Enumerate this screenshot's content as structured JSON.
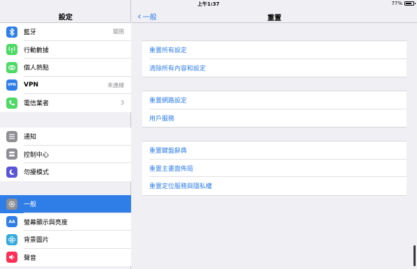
{
  "status_bar": {
    "time": "上午1:37",
    "battery": "77%",
    "battery_level": 0.77
  },
  "sidebar": {
    "title": "設定",
    "group1": [
      {
        "label": "藍牙",
        "value": "關閉",
        "icon": "bluetooth-icon",
        "color": "#2f7ee8"
      },
      {
        "label": "行動數據",
        "value": "",
        "icon": "cellular-antenna-icon",
        "color": "#4cd964"
      },
      {
        "label": "個人熱點",
        "value": "",
        "icon": "hotspot-link-icon",
        "color": "#4cd964"
      },
      {
        "label": "VPN",
        "value": "未連線",
        "icon": "vpn-icon",
        "color": "#2f7ee8"
      },
      {
        "label": "電信業者",
        "value": "3",
        "icon": "phone-icon",
        "color": "#4cd964"
      }
    ],
    "group2": [
      {
        "label": "通知",
        "icon": "notifications-icon",
        "color": "#8e8e93"
      },
      {
        "label": "控制中心",
        "icon": "control-center-icon",
        "color": "#8e8e93"
      },
      {
        "label": "勿擾模式",
        "icon": "moon-icon",
        "color": "#5856d6"
      }
    ],
    "group3": [
      {
        "label": "一般",
        "icon": "gear-icon",
        "color": "#8e8e93",
        "selected": true
      },
      {
        "label": "螢幕顯示與亮度",
        "icon": "brightness-aa-icon",
        "color": "#2f7ee8"
      },
      {
        "label": "背景圖片",
        "icon": "wallpaper-flower-icon",
        "color": "#34aadc"
      },
      {
        "label": "聲音",
        "icon": "speaker-icon",
        "color": "#ff2d55"
      }
    ]
  },
  "navbar": {
    "back_label": "一般",
    "title": "重置"
  },
  "reset": {
    "group1": [
      "重置所有設定",
      "清除所有內容和設定"
    ],
    "group2": [
      "重置網路設定",
      "用戶服務"
    ],
    "group3": [
      "重置鍵盤辭典",
      "重置主畫面佈局",
      "重置定位服務與隱私權"
    ]
  },
  "icon_glyphs": {
    "vpn": "VPN",
    "aa": "AA"
  }
}
